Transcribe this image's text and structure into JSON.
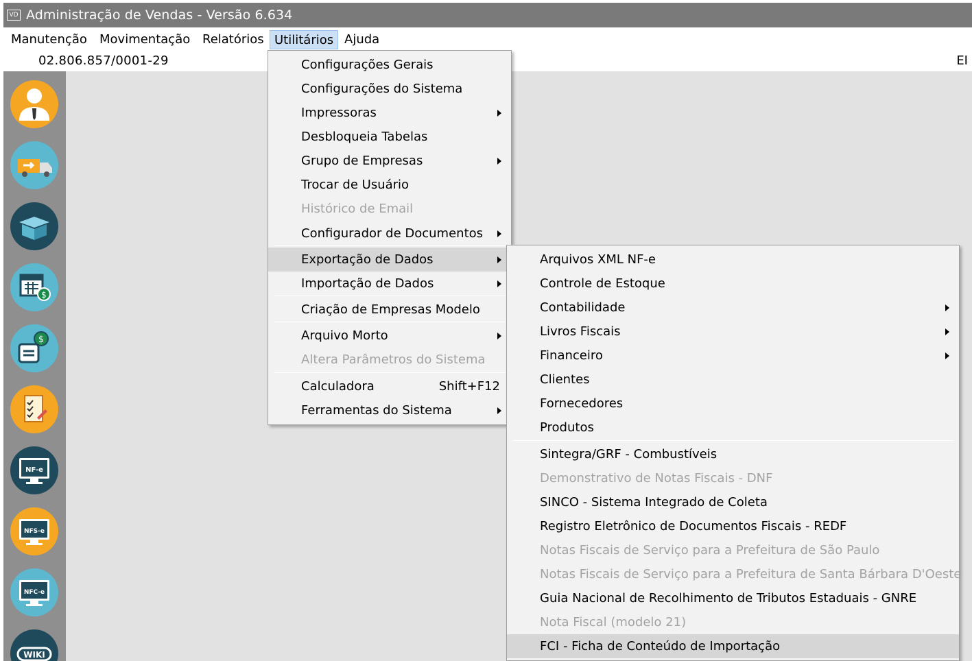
{
  "window": {
    "title": "Administração de Vendas - Versão 6.634",
    "icon_text": "VD"
  },
  "menubar": {
    "items": [
      "Manutenção",
      "Movimentação",
      "Relatórios",
      "Utilitários",
      "Ajuda"
    ],
    "active": "Utilitários"
  },
  "infobar": {
    "cnpj": "02.806.857/0001-29",
    "right_fragment": "EI"
  },
  "sidebar": {
    "icons": [
      "user-icon",
      "truck-icon",
      "box-icon",
      "calendar-money-icon",
      "money-document-icon",
      "checklist-icon",
      "nfe-monitor-icon",
      "nfse-monitor-icon",
      "nfce-monitor-icon",
      "wiki-icon"
    ],
    "labels": {
      "nfe": "NF-e",
      "nfse": "NFS-e",
      "nfce": "NFC-e",
      "wiki": "WIKI"
    },
    "colors": {
      "orange": "#f5a623",
      "light_blue": "#5bb8cf",
      "dark_teal": "#1f4a5c",
      "panel": "#8f8f8f"
    }
  },
  "utilitarios_menu": {
    "items": [
      {
        "label": "Configurações Gerais"
      },
      {
        "label": "Configurações do Sistema"
      },
      {
        "label": "Impressoras",
        "submenu": true
      },
      {
        "label": "Desbloqueia Tabelas"
      },
      {
        "label": "Grupo de Empresas",
        "submenu": true
      },
      {
        "label": "Trocar de Usuário"
      },
      {
        "label": "Histórico de Email",
        "disabled": true
      },
      {
        "label": "Configurador de Documentos",
        "submenu": true
      },
      {
        "label": "Exportação de Dados",
        "submenu": true,
        "highlighted": true
      },
      {
        "label": "Importação de Dados",
        "submenu": true
      },
      {
        "label": "Criação de Empresas Modelo"
      },
      {
        "label": "Arquivo Morto",
        "submenu": true
      },
      {
        "label": "Altera Parâmetros do Sistema",
        "disabled": true
      },
      {
        "label": "Calculadora",
        "shortcut": "Shift+F12"
      },
      {
        "label": "Ferramentas do Sistema",
        "submenu": true
      }
    ]
  },
  "exportacao_submenu": {
    "items": [
      {
        "label": "Arquivos XML NF-e"
      },
      {
        "label": "Controle de Estoque"
      },
      {
        "label": "Contabilidade",
        "submenu": true
      },
      {
        "label": "Livros Fiscais",
        "submenu": true
      },
      {
        "label": "Financeiro",
        "submenu": true
      },
      {
        "label": "Clientes"
      },
      {
        "label": "Fornecedores"
      },
      {
        "label": "Produtos"
      },
      {
        "label": "Sintegra/GRF - Combustíveis"
      },
      {
        "label": "Demonstrativo de Notas Fiscais - DNF",
        "disabled": true
      },
      {
        "label": "SINCO - Sistema Integrado de Coleta"
      },
      {
        "label": "Registro Eletrônico de Documentos Fiscais - REDF"
      },
      {
        "label": "Notas Fiscais de Serviço para a Prefeitura de São Paulo",
        "disabled": true
      },
      {
        "label": "Notas Fiscais de Serviço para a Prefeitura de Santa Bárbara D'Oeste",
        "disabled": true
      },
      {
        "label": "Guia Nacional de Recolhimento de Tributos Estaduais - GNRE"
      },
      {
        "label": "Nota Fiscal (modelo 21)",
        "disabled": true
      },
      {
        "label": "FCI - Ficha de Conteúdo de Importação",
        "highlighted": true
      }
    ]
  }
}
